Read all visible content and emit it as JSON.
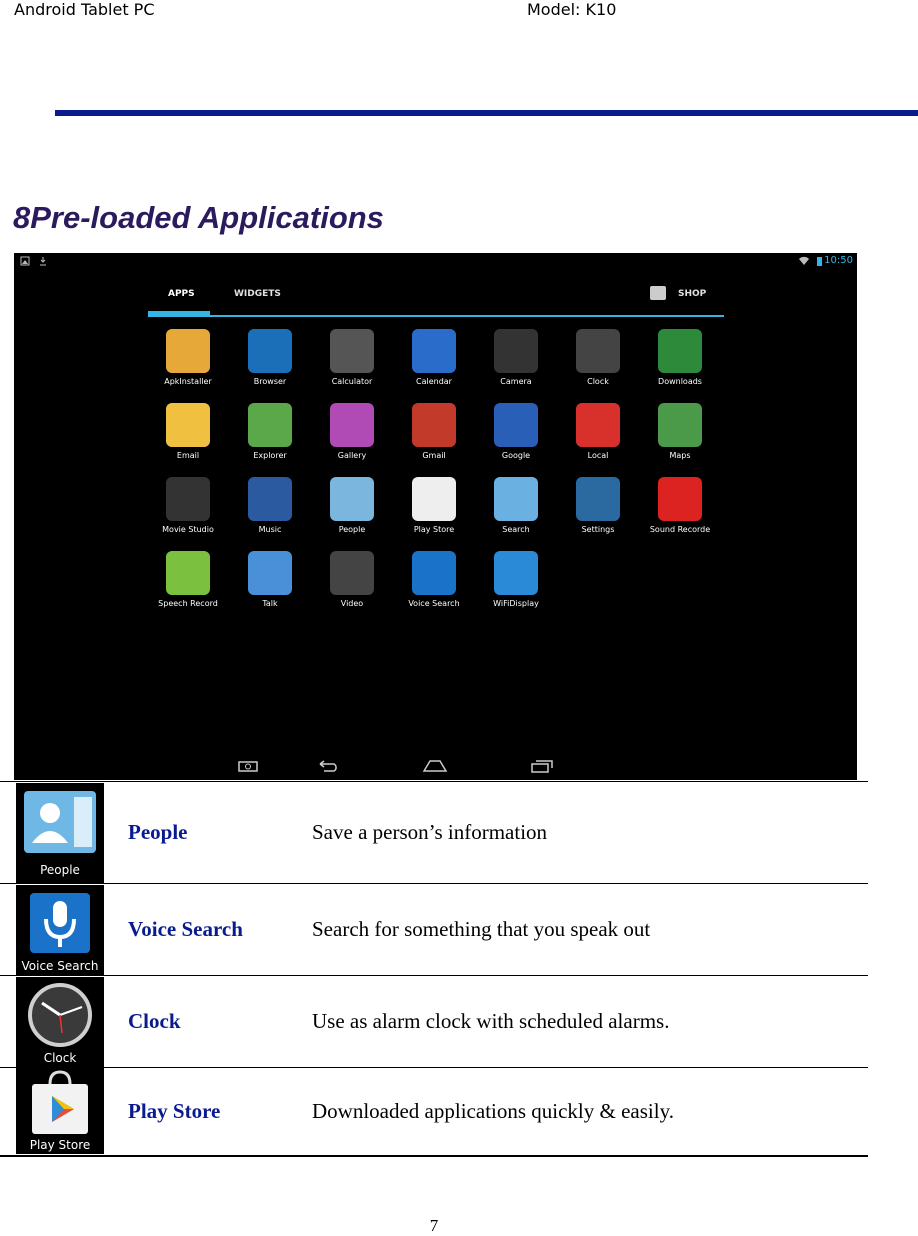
{
  "header": {
    "left": "Android Tablet PC",
    "right": "Model: K10"
  },
  "section": {
    "title": "8Pre-loaded Applications"
  },
  "screenshot": {
    "status_time": "10:50",
    "tabs": {
      "apps": "APPS",
      "widgets": "WIDGETS",
      "shop": "SHOP"
    },
    "apps": [
      {
        "label": "ApkInstaller"
      },
      {
        "label": "Browser"
      },
      {
        "label": "Calculator"
      },
      {
        "label": "Calendar"
      },
      {
        "label": "Camera"
      },
      {
        "label": "Clock"
      },
      {
        "label": "Downloads"
      },
      {
        "label": "Email"
      },
      {
        "label": "Explorer"
      },
      {
        "label": "Gallery"
      },
      {
        "label": "Gmail"
      },
      {
        "label": "Google"
      },
      {
        "label": "Local"
      },
      {
        "label": "Maps"
      },
      {
        "label": "Movie Studio"
      },
      {
        "label": "Music"
      },
      {
        "label": "People"
      },
      {
        "label": "Play Store"
      },
      {
        "label": "Search"
      },
      {
        "label": "Settings"
      },
      {
        "label": "Sound Recorde"
      },
      {
        "label": "Speech Record"
      },
      {
        "label": "Talk"
      },
      {
        "label": "Video"
      },
      {
        "label": "Voice Search"
      },
      {
        "label": "WiFiDisplay"
      }
    ]
  },
  "table": {
    "rows": [
      {
        "icon_caption": "People",
        "name": "People",
        "description": "Save a person’s information"
      },
      {
        "icon_caption": "Voice Search",
        "name": "Voice Search",
        "description": "Search for something that you speak out"
      },
      {
        "icon_caption": "Clock",
        "name": "Clock",
        "description": "Use as alarm clock with scheduled alarms."
      },
      {
        "icon_caption": "Play Store",
        "name": "Play Store",
        "description": "Downloaded applications quickly & easily."
      }
    ]
  },
  "footer": {
    "page_number": "7"
  }
}
